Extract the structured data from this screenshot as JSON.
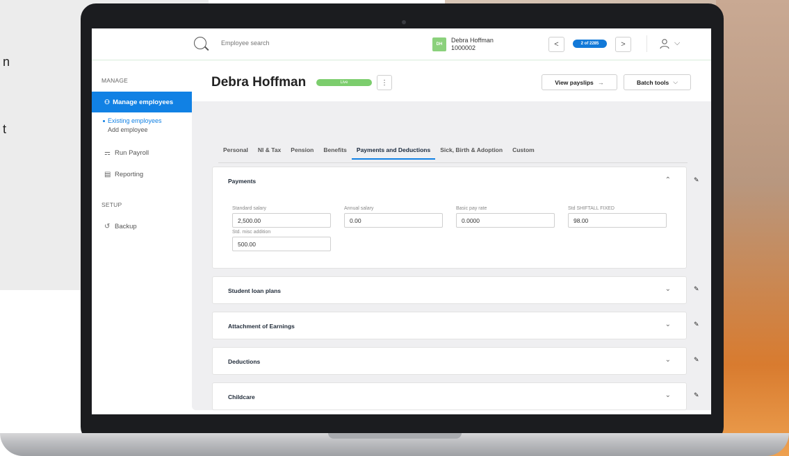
{
  "background": {
    "partial_letters": [
      "n",
      "t"
    ]
  },
  "topbar": {
    "search_placeholder": "Employee search",
    "employee": {
      "initials": "DH",
      "name": "Debra Hoffman",
      "id": "1000002"
    },
    "pager": "2 of 2285",
    "prev_label": "<",
    "next_label": ">",
    "user_chevron": "⌵"
  },
  "sidebar": {
    "manage_heading": "MANAGE",
    "manage_employees": "Manage employees",
    "existing_employees": "Existing employees",
    "add_employee": "Add employee",
    "run_payroll": "Run Payroll",
    "reporting": "Reporting",
    "setup_heading": "SETUP",
    "backup": "Backup"
  },
  "header": {
    "title": "Debra Hoffman",
    "status": "Live",
    "kebab": "⋮",
    "view_payslips": "View payslips",
    "view_payslips_arrow": "→",
    "batch_tools": "Batch tools",
    "batch_tools_chevron": "⌵"
  },
  "tabs": [
    {
      "label": "Personal"
    },
    {
      "label": "NI & Tax"
    },
    {
      "label": "Pension"
    },
    {
      "label": "Benefits"
    },
    {
      "label": "Payments and Deductions",
      "active": true
    },
    {
      "label": "Sick, Birth & Adoption"
    },
    {
      "label": "Custom"
    }
  ],
  "payments": {
    "title": "Payments",
    "fields": [
      {
        "label": "Standard salary",
        "value": "2,500.00"
      },
      {
        "label": "Annual salary",
        "value": "0.00"
      },
      {
        "label": "Basic pay rate",
        "value": "0.0000"
      },
      {
        "label": "Std SHIFTALL FIXED",
        "value": "98.00"
      },
      {
        "label": "Std. misc addition",
        "value": "500.00"
      }
    ]
  },
  "sections": [
    {
      "title": "Student loan plans"
    },
    {
      "title": "Attachment of Earnings"
    },
    {
      "title": "Deductions"
    },
    {
      "title": "Childcare"
    }
  ],
  "colors": {
    "accent": "#1181e4",
    "live": "#7ccd6d",
    "content_bg": "#efeff1"
  }
}
